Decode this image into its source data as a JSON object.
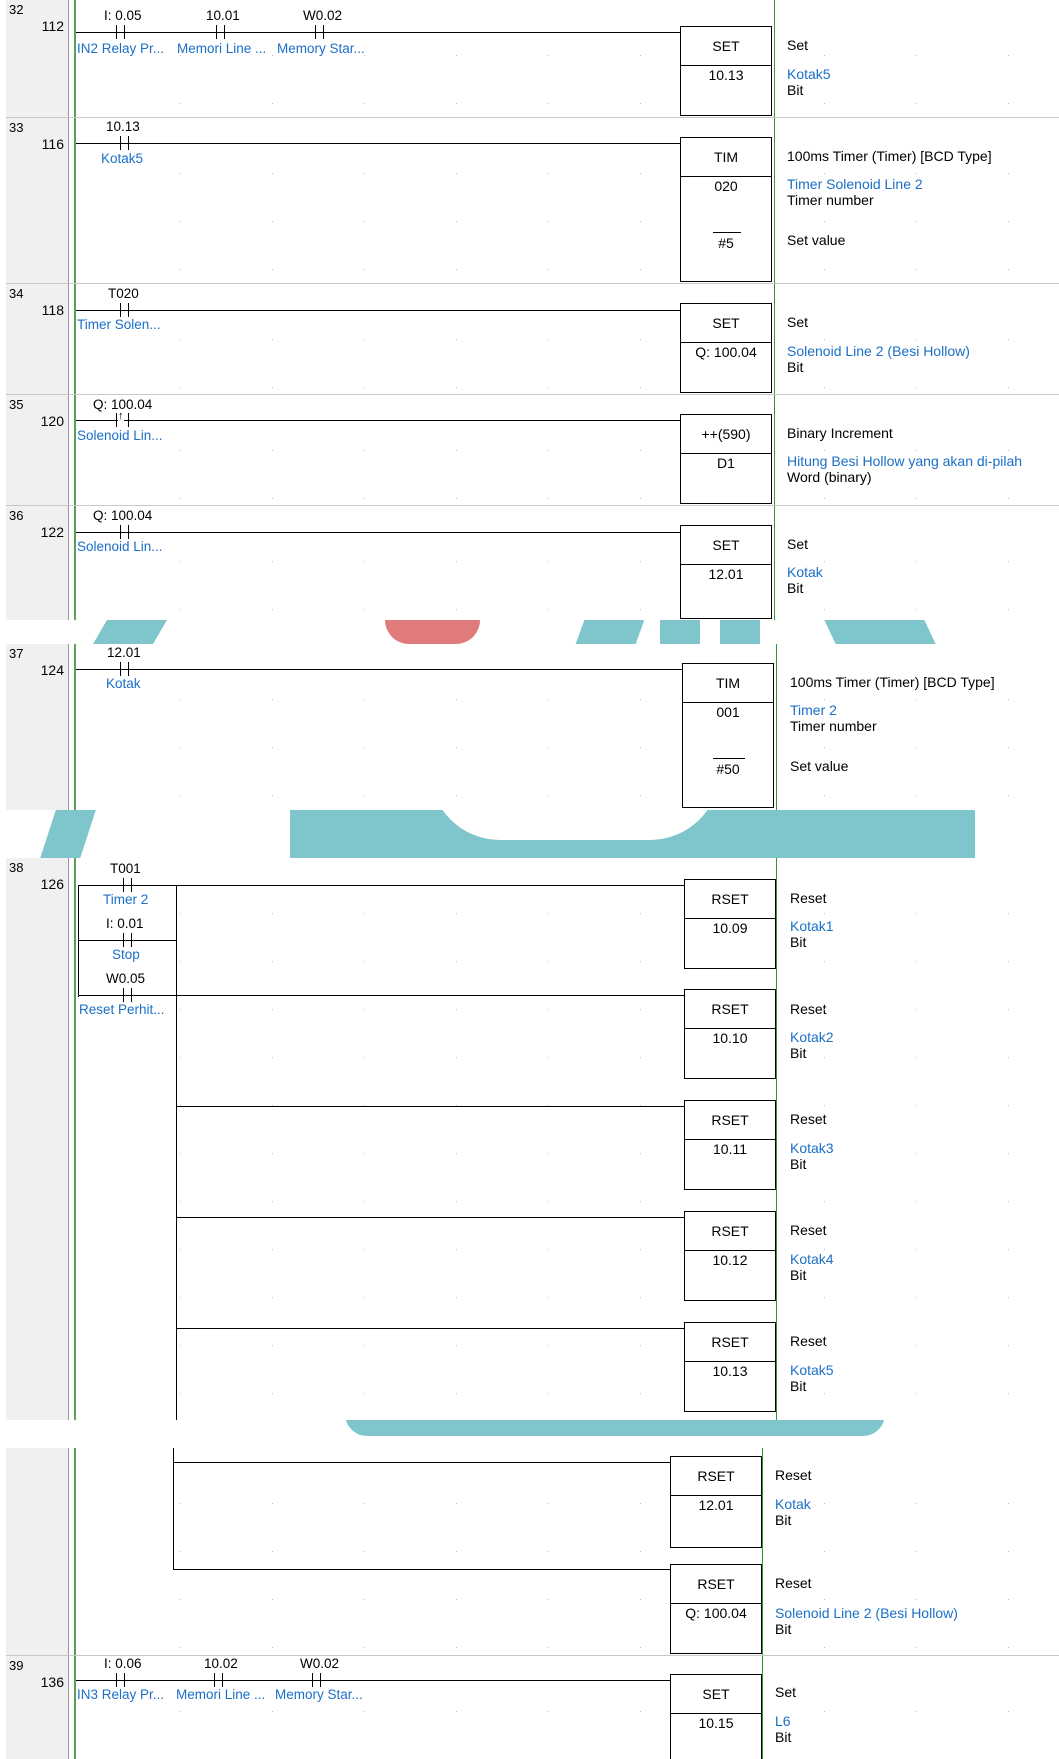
{
  "rungs": {
    "r32": {
      "number": "32",
      "step": "112",
      "contacts": [
        {
          "address": "I: 0.05",
          "symbol": "IN2 Relay Pr..."
        },
        {
          "address": "10.01",
          "symbol": "Memori Line ..."
        },
        {
          "address": "W0.02",
          "symbol": "Memory Star..."
        }
      ],
      "instr": {
        "op": "SET",
        "operand": "10.13"
      },
      "desc": {
        "title": "Set",
        "name": "Kotak5",
        "type": "Bit"
      }
    },
    "r33": {
      "number": "33",
      "step": "116",
      "contacts": [
        {
          "address": "10.13",
          "symbol": "Kotak5"
        }
      ],
      "instr": {
        "op": "TIM",
        "operand": "020",
        "setval": "#5"
      },
      "desc": {
        "title": "100ms Timer (Timer) [BCD Type]",
        "name": "Timer Solenoid Line 2",
        "type": "Timer number",
        "setlabel": "Set value"
      }
    },
    "r34": {
      "number": "34",
      "step": "118",
      "contacts": [
        {
          "address": "T020",
          "symbol": "Timer Solen..."
        }
      ],
      "instr": {
        "op": "SET",
        "operand": "Q: 100.04"
      },
      "desc": {
        "title": "Set",
        "name": "Solenoid Line 2 (Besi Hollow)",
        "type": "Bit"
      }
    },
    "r35": {
      "number": "35",
      "step": "120",
      "contacts": [
        {
          "address": "Q: 100.04",
          "symbol": "Solenoid Lin...",
          "glyph": "↑"
        }
      ],
      "instr": {
        "op": "++(590)",
        "operand": "D1"
      },
      "desc": {
        "title": "Binary Increment",
        "name": "Hitung Besi Hollow yang akan di-pilah",
        "type": "Word (binary)"
      }
    },
    "r36": {
      "number": "36",
      "step": "122",
      "contacts": [
        {
          "address": "Q: 100.04",
          "symbol": "Solenoid Lin..."
        }
      ],
      "instr": {
        "op": "SET",
        "operand": "12.01"
      },
      "desc": {
        "title": "Set",
        "name": "Kotak",
        "type": "Bit"
      }
    },
    "r37": {
      "number": "37",
      "step": "124",
      "contacts": [
        {
          "address": "12.01",
          "symbol": "Kotak"
        }
      ],
      "instr": {
        "op": "TIM",
        "operand": "001",
        "setval": "#50"
      },
      "desc": {
        "title": "100ms Timer (Timer) [BCD Type]",
        "name": "Timer 2",
        "type": "Timer number",
        "setlabel": "Set value"
      }
    },
    "r38": {
      "number": "38",
      "step": "126",
      "contacts": [
        {
          "address": "T001",
          "symbol": "Timer 2"
        },
        {
          "address": "I: 0.01",
          "symbol": "Stop"
        },
        {
          "address": "W0.05",
          "symbol": "Reset Perhit..."
        }
      ],
      "outputs": [
        {
          "op": "RSET",
          "operand": "10.09",
          "title": "Reset",
          "name": "Kotak1",
          "type": "Bit"
        },
        {
          "op": "RSET",
          "operand": "10.10",
          "title": "Reset",
          "name": "Kotak2",
          "type": "Bit"
        },
        {
          "op": "RSET",
          "operand": "10.11",
          "title": "Reset",
          "name": "Kotak3",
          "type": "Bit"
        },
        {
          "op": "RSET",
          "operand": "10.12",
          "title": "Reset",
          "name": "Kotak4",
          "type": "Bit"
        },
        {
          "op": "RSET",
          "operand": "10.13",
          "title": "Reset",
          "name": "Kotak5",
          "type": "Bit"
        },
        {
          "op": "RSET",
          "operand": "12.01",
          "title": "Reset",
          "name": "Kotak",
          "type": "Bit"
        },
        {
          "op": "RSET",
          "operand": "Q: 100.04",
          "title": "Reset",
          "name": "Solenoid Line 2 (Besi Hollow)",
          "type": "Bit"
        }
      ]
    },
    "r39": {
      "number": "39",
      "step": "136",
      "contacts": [
        {
          "address": "I: 0.06",
          "symbol": "IN3 Relay Pr..."
        },
        {
          "address": "10.02",
          "symbol": "Memori Line ..."
        },
        {
          "address": "W0.02",
          "symbol": "Memory Star..."
        }
      ],
      "instr": {
        "op": "SET",
        "operand": "10.15"
      },
      "desc": {
        "title": "Set",
        "name": "L6",
        "type": "Bit"
      }
    }
  },
  "colors": {
    "symbol": "#1a6fc7",
    "rail": "#2f9a2f",
    "gutter": "#f0f0f0",
    "watermark": "#7fc6cc",
    "watermark_red": "#e07b7b"
  }
}
